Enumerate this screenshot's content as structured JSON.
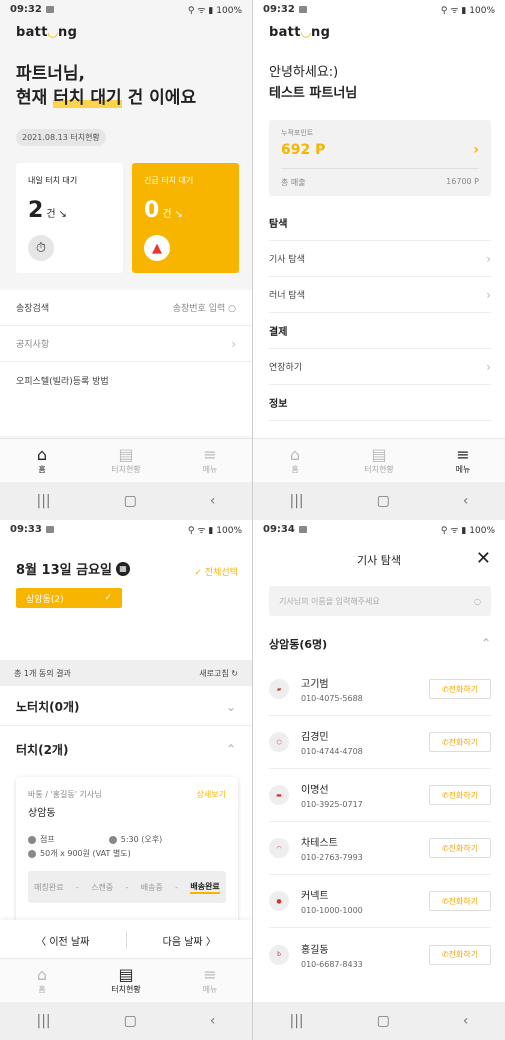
{
  "brand": {
    "logo_pre": "batt",
    "logo_o": "◡",
    "logo_post": "ng",
    "accent": "#f7b500"
  },
  "screens": [
    {
      "status": {
        "time": "09:32",
        "battery": "100%"
      },
      "heading_line1": "파트너님,",
      "heading_pre": "현재 ",
      "heading_hl": "터치 대기",
      "heading_post": " 건 이에요",
      "date_chip": "2021.08.13 터치현황",
      "card1": {
        "label": "내일 터치 대기",
        "count": "2",
        "unit": "건",
        "icon": "stopwatch-icon"
      },
      "card2": {
        "label": "긴급 터치 대기",
        "count": "0",
        "unit": "건",
        "icon": "siren-icon"
      },
      "search_label": "송장검색",
      "search_placeholder": "송장번호 입력",
      "notice_label": "공지사항",
      "notice_item": "오피스텔(빌라)등록 방법",
      "tabs": [
        "홈",
        "터치현황",
        "메뉴"
      ],
      "active_tab": 0
    },
    {
      "status": {
        "time": "09:32",
        "battery": "100%"
      },
      "greet1": "안녕하세요:)",
      "greet2": "테스트 파트너님",
      "points_label": "누적포인트",
      "points_value": "692 P",
      "total_label": "총 매출",
      "total_value": "16700 P",
      "menu": {
        "sec1": "탐색",
        "item1": "기사 탐색",
        "item2": "러너 탐색",
        "sec2": "결제",
        "item3": "연장하기",
        "sec3": "정보"
      },
      "tabs": [
        "홈",
        "터치현황",
        "메뉴"
      ],
      "active_tab": 2
    },
    {
      "status": {
        "time": "09:33",
        "battery": "100%"
      },
      "date": "8월 13일 금요일",
      "select_all": "✓ 전체선택",
      "chip": "상암동(2)",
      "result": "총 1개 동의 결과",
      "refresh": "새로고침",
      "group1": "노터치(0개)",
      "group2": "터치(2개)",
      "delivery": {
        "driver": "바통 / '홍길동' 기사님",
        "detail": "상세보기",
        "area": "상암동",
        "loc": "점프",
        "time": "5:30 (오후)",
        "price": "50개 x 900원 (VAT 별도)",
        "steps": [
          "매칭완료",
          "-",
          "스캔중",
          "-",
          "배송중",
          "-",
          "배송완료"
        ]
      },
      "prev": "〈 이전 날짜",
      "next": "다음 날짜 〉",
      "tabs": [
        "홈",
        "터치현황",
        "메뉴"
      ],
      "active_tab": 1
    },
    {
      "status": {
        "time": "09:34",
        "battery": "100%"
      },
      "title": "기사 탐색",
      "search_placeholder": "기사님의 이름을 입력해주세요",
      "area": "상암동(6명)",
      "call_label": "전화하기",
      "drivers": [
        {
          "name": "고기범",
          "phone": "010-4075-5688"
        },
        {
          "name": "김경민",
          "phone": "010-4744-4708"
        },
        {
          "name": "이명선",
          "phone": "010-3925-0717"
        },
        {
          "name": "차테스트",
          "phone": "010-2763-7993"
        },
        {
          "name": "커넥트",
          "phone": "010-1000-1000"
        },
        {
          "name": "홍길동",
          "phone": "010-6687-8433"
        }
      ]
    }
  ]
}
